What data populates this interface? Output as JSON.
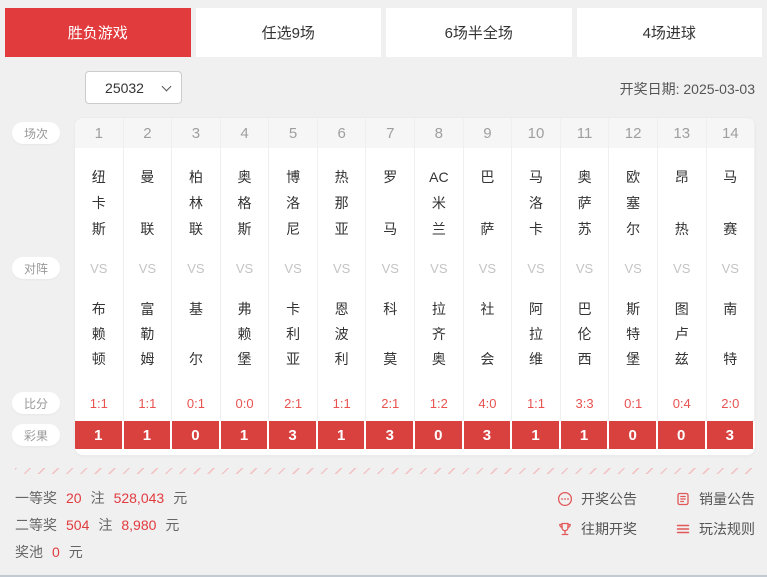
{
  "tabs": [
    {
      "label": "胜负游戏",
      "active": true
    },
    {
      "label": "任选9场",
      "active": false
    },
    {
      "label": "6场半全场",
      "active": false
    },
    {
      "label": "4场进球",
      "active": false
    }
  ],
  "controls": {
    "issue": "25032",
    "draw_date": "开奖日期: 2025-03-03"
  },
  "table": {
    "row_labels": {
      "match": "场次",
      "versus": "对阵",
      "score": "比分",
      "result": "彩果"
    },
    "vs_label": "VS",
    "matches": [
      {
        "no": "1",
        "home": [
          "纽",
          "卡",
          "斯"
        ],
        "away": [
          "布",
          "赖",
          "顿"
        ],
        "score": "1:1",
        "result": "1"
      },
      {
        "no": "2",
        "home": [
          "曼",
          "联"
        ],
        "away": [
          "富",
          "勒",
          "姆"
        ],
        "score": "1:1",
        "result": "1"
      },
      {
        "no": "3",
        "home": [
          "柏",
          "林",
          "联"
        ],
        "away": [
          "基",
          "尔"
        ],
        "score": "0:1",
        "result": "0"
      },
      {
        "no": "4",
        "home": [
          "奥",
          "格",
          "斯"
        ],
        "away": [
          "弗",
          "赖",
          "堡"
        ],
        "score": "0:0",
        "result": "1"
      },
      {
        "no": "5",
        "home": [
          "博",
          "洛",
          "尼"
        ],
        "away": [
          "卡",
          "利",
          "亚"
        ],
        "score": "2:1",
        "result": "3"
      },
      {
        "no": "6",
        "home": [
          "热",
          "那",
          "亚"
        ],
        "away": [
          "恩",
          "波",
          "利"
        ],
        "score": "1:1",
        "result": "1"
      },
      {
        "no": "7",
        "home": [
          "罗",
          "马"
        ],
        "away": [
          "科",
          "莫"
        ],
        "score": "2:1",
        "result": "3"
      },
      {
        "no": "8",
        "home": [
          "AC",
          "米",
          "兰"
        ],
        "away": [
          "拉",
          "齐",
          "奥"
        ],
        "score": "1:2",
        "result": "0"
      },
      {
        "no": "9",
        "home": [
          "巴",
          "萨"
        ],
        "away": [
          "社",
          "会"
        ],
        "score": "4:0",
        "result": "3"
      },
      {
        "no": "10",
        "home": [
          "马",
          "洛",
          "卡"
        ],
        "away": [
          "阿",
          "拉",
          "维"
        ],
        "score": "1:1",
        "result": "1"
      },
      {
        "no": "11",
        "home": [
          "奥",
          "萨",
          "苏"
        ],
        "away": [
          "巴",
          "伦",
          "西"
        ],
        "score": "3:3",
        "result": "1"
      },
      {
        "no": "12",
        "home": [
          "欧",
          "塞",
          "尔"
        ],
        "away": [
          "斯",
          "特",
          "堡"
        ],
        "score": "0:1",
        "result": "0"
      },
      {
        "no": "13",
        "home": [
          "昂",
          "热"
        ],
        "away": [
          "图",
          "卢",
          "兹"
        ],
        "score": "0:4",
        "result": "0"
      },
      {
        "no": "14",
        "home": [
          "马",
          "赛"
        ],
        "away": [
          "南",
          "特"
        ],
        "score": "2:0",
        "result": "3"
      }
    ]
  },
  "summary": {
    "prizes": [
      {
        "label": "一等奖",
        "count": "20",
        "count_unit": "注",
        "amount": "528,043",
        "amount_unit": "元"
      },
      {
        "label": "二等奖",
        "count": "504",
        "count_unit": "注",
        "amount": "8,980",
        "amount_unit": "元"
      },
      {
        "label": "奖池",
        "count": "",
        "count_unit": "",
        "amount": "0",
        "amount_unit": "元"
      }
    ],
    "links": [
      {
        "label": "开奖公告",
        "icon": "chat-dots-icon"
      },
      {
        "label": "销量公告",
        "icon": "sales-doc-icon"
      },
      {
        "label": "往期开奖",
        "icon": "trophy-icon"
      },
      {
        "label": "玩法规则",
        "icon": "rules-lines-icon"
      }
    ]
  },
  "colors": {
    "accent_red": "#e13b3e",
    "result_row_bg": "#d9413f",
    "score_text": "#e85351",
    "icon_red": "#e25757",
    "page_bg": "#f0f0f1"
  }
}
